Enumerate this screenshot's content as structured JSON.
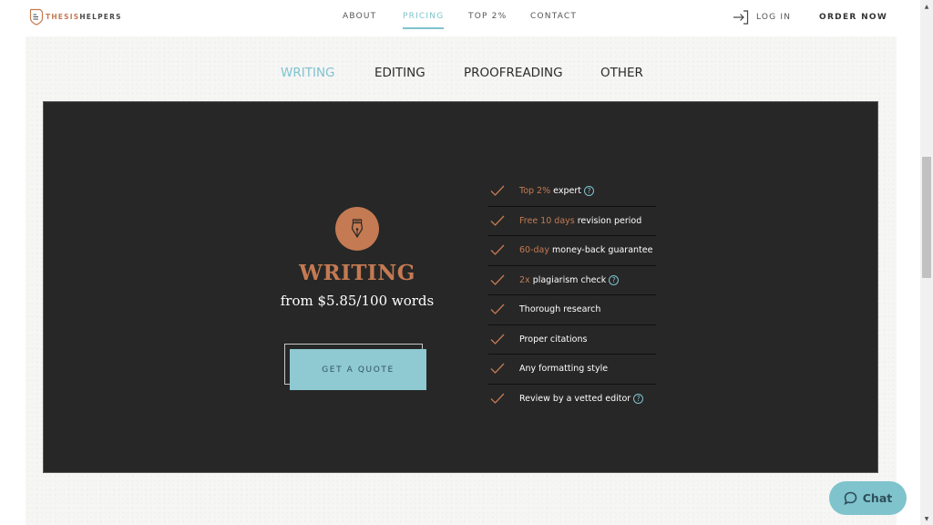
{
  "brand": {
    "name_part1": "THESIS",
    "name_part2": "HELPERS",
    "logo_icon": "document-shield-icon",
    "accent_color": "#c47a52",
    "secondary_color": "#7fc3cd"
  },
  "nav": {
    "items": [
      {
        "label": "ABOUT",
        "active": false
      },
      {
        "label": "PRICING",
        "active": true
      },
      {
        "label": "TOP 2%",
        "active": false
      },
      {
        "label": "CONTACT",
        "active": false
      }
    ],
    "login_label": "LOG IN",
    "login_icon": "login-arrow-icon",
    "order_label": "ORDER NOW"
  },
  "tabs": [
    {
      "label": "WRITING",
      "active": true
    },
    {
      "label": "EDITING",
      "active": false
    },
    {
      "label": "PROOFREADING",
      "active": false
    },
    {
      "label": "OTHER",
      "active": false
    }
  ],
  "service": {
    "icon": "fountain-pen-icon",
    "title": "WRITING",
    "price": "from $5.85/100 words",
    "cta_label": "GET A QUOTE"
  },
  "features": [
    {
      "highlight": "Top 2%",
      "text": " expert",
      "help": true
    },
    {
      "highlight": "Free 10 days",
      "text": " revision period",
      "help": false
    },
    {
      "highlight": "60-day",
      "text": " money-back guarantee",
      "help": false
    },
    {
      "highlight": "2x",
      "text": " plagiarism check",
      "help": true
    },
    {
      "highlight": "",
      "text": "Thorough research",
      "help": false
    },
    {
      "highlight": "",
      "text": "Proper citations",
      "help": false
    },
    {
      "highlight": "",
      "text": "Any formatting style",
      "help": false
    },
    {
      "highlight": "",
      "text": "Review by a vetted editor",
      "help": true
    }
  ],
  "help_glyph": "?",
  "chat": {
    "label": "Chat",
    "icon": "chat-bubble-icon"
  },
  "scrollbar": {
    "up_glyph": "▲",
    "down_glyph": "▼"
  }
}
